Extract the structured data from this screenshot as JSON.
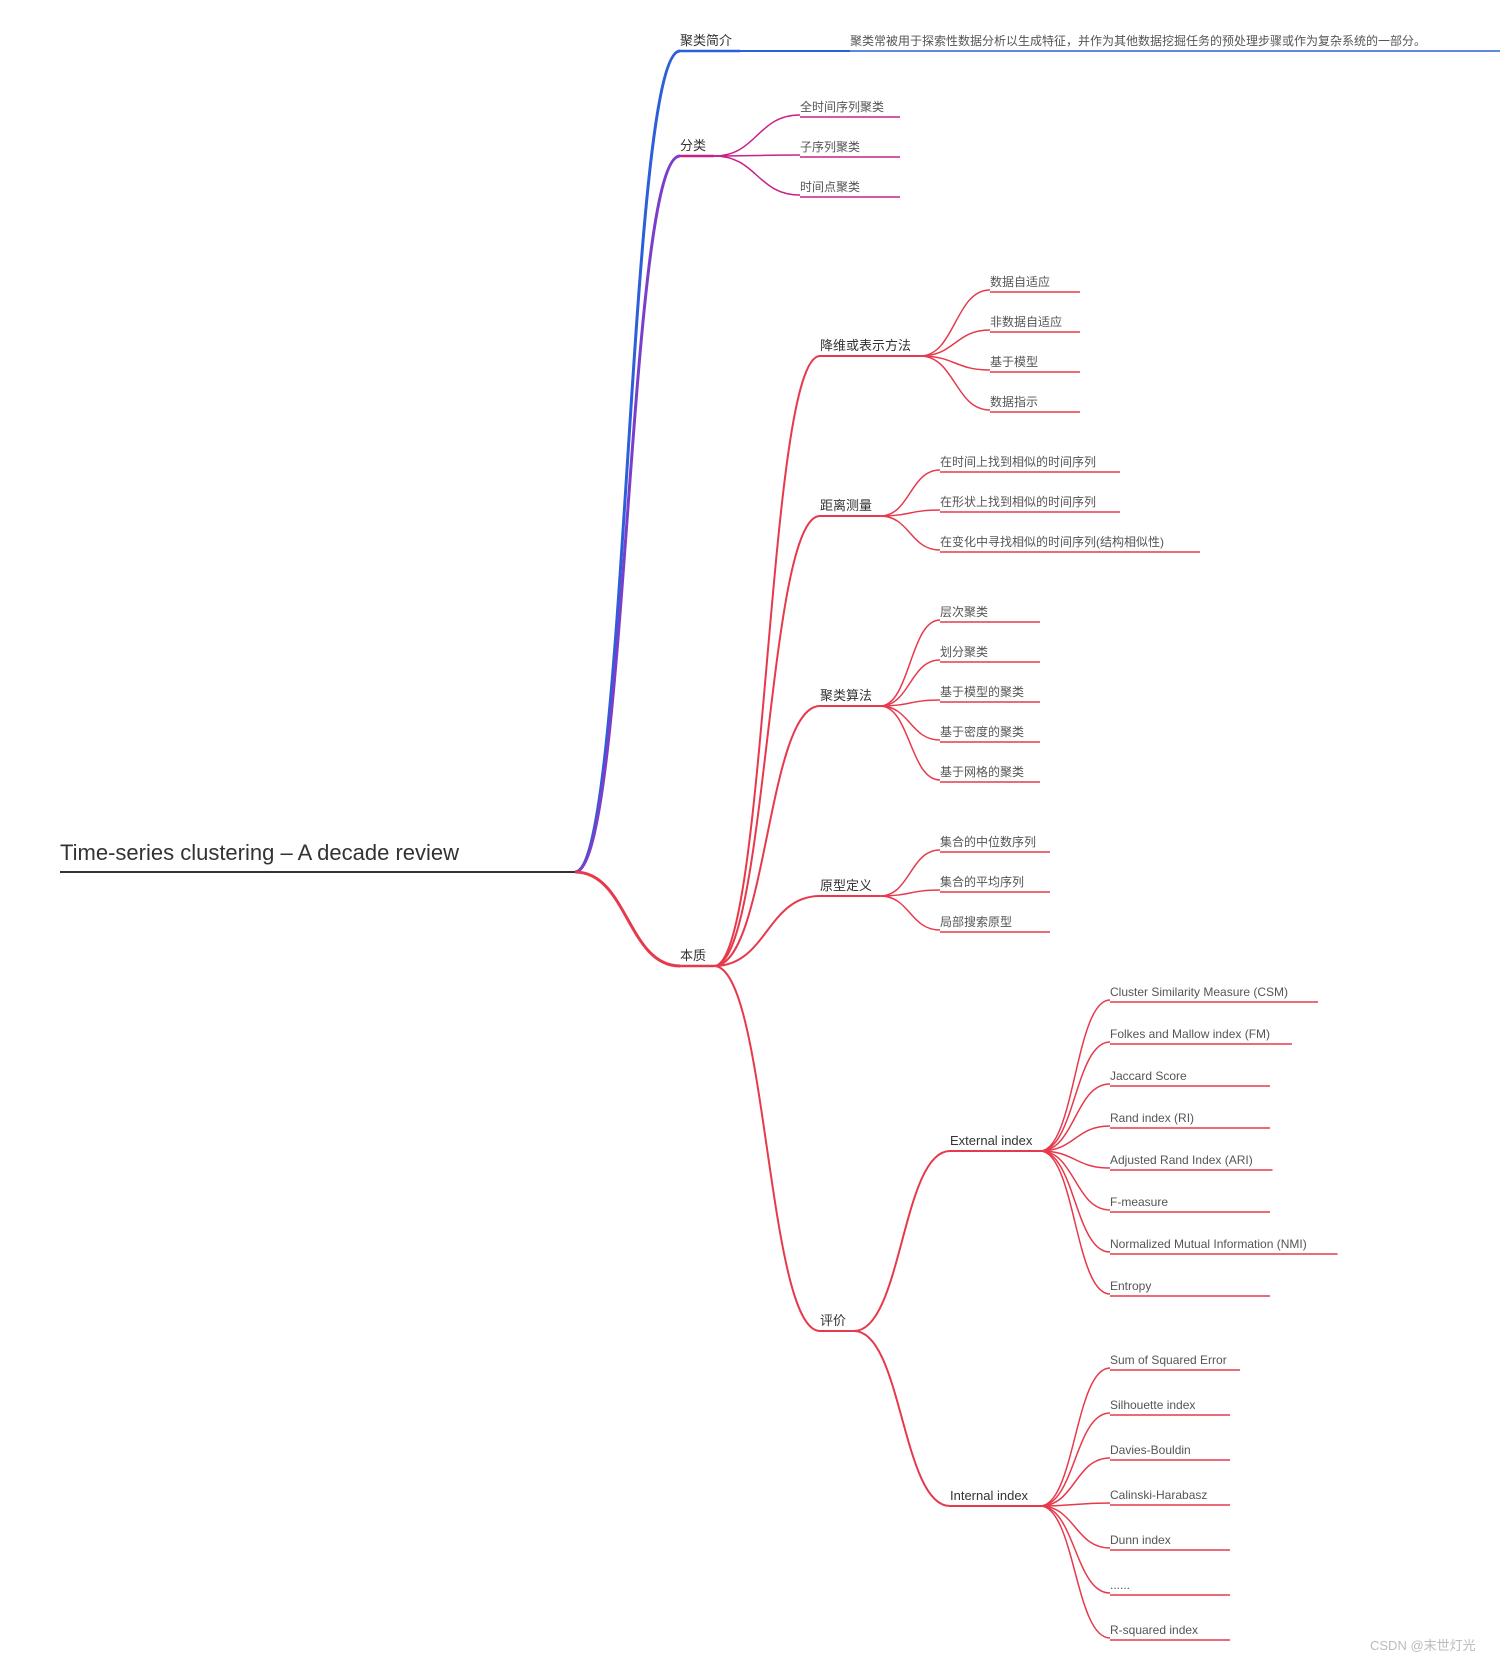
{
  "root": "Time-series clustering – A decade review",
  "n1": {
    "label": "聚类简介",
    "desc": "聚类常被用于探索性数据分析以生成特征，并作为其他数据挖掘任务的预处理步骤或作为复杂系统的一部分。"
  },
  "n2": {
    "label": "分类",
    "c": [
      "全时间序列聚类",
      "子序列聚类",
      "时间点聚类"
    ]
  },
  "n3": {
    "label": "本质",
    "s1": {
      "label": "降维或表示方法",
      "c": [
        "数据自适应",
        "非数据自适应",
        "基于模型",
        "数据指示"
      ]
    },
    "s2": {
      "label": "距离测量",
      "c": [
        "在时间上找到相似的时间序列",
        "在形状上找到相似的时间序列",
        "在变化中寻找相似的时间序列(结构相似性)"
      ]
    },
    "s3": {
      "label": "聚类算法",
      "c": [
        "层次聚类",
        "划分聚类",
        "基于模型的聚类",
        "基于密度的聚类",
        "基于网格的聚类"
      ]
    },
    "s4": {
      "label": "原型定义",
      "c": [
        "集合的中位数序列",
        "集合的平均序列",
        "局部搜索原型"
      ]
    },
    "s5": {
      "label": "评价",
      "ext": {
        "label": "External index",
        "c": [
          "Cluster Similarity Measure (CSM)",
          "Folkes and Mallow index (FM)",
          "Jaccard Score",
          "Rand index (RI)",
          "Adjusted Rand Index (ARI)",
          "F-measure",
          "Normalized Mutual Information (NMI)",
          "Entropy"
        ]
      },
      "int": {
        "label": "Internal index",
        "c": [
          "Sum of Squared Error",
          "Silhouette index",
          "Davies-Bouldin",
          "Calinski-Harabasz",
          "Dunn index",
          "......",
          "R-squared index"
        ]
      }
    }
  },
  "watermark": "CSDN @末世灯光",
  "colors": {
    "blue": "#2d5fd8",
    "purple": "#7a3ecb",
    "magenta": "#c9208a",
    "red": "#e63a4c"
  }
}
